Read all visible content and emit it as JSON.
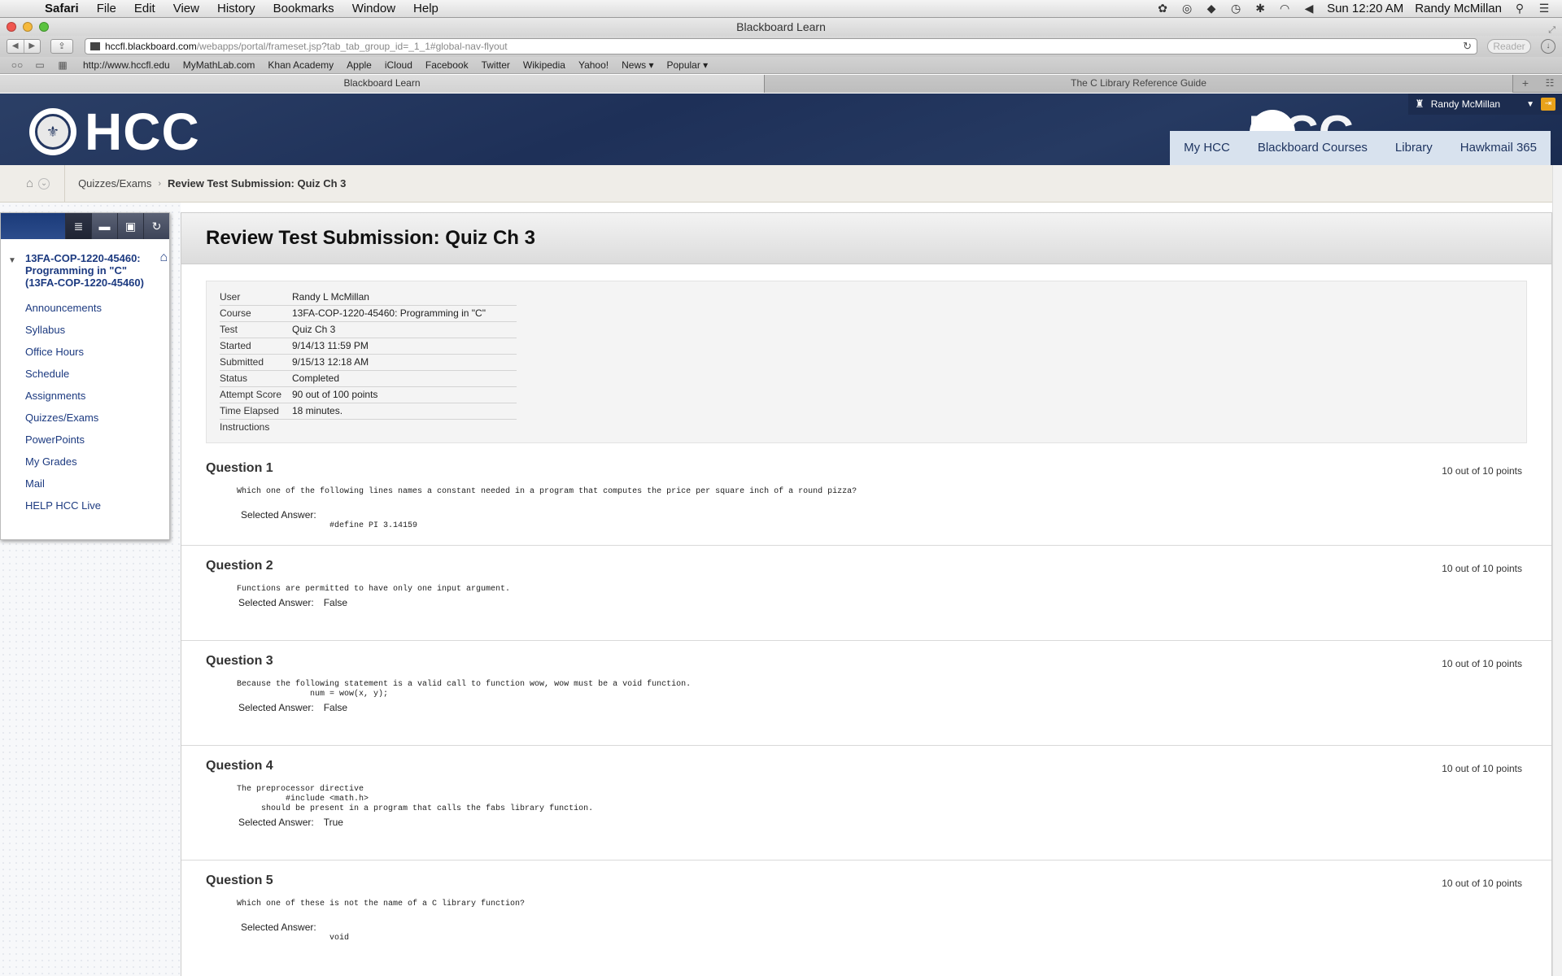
{
  "menubar": {
    "app": "Safari",
    "items": [
      "File",
      "Edit",
      "View",
      "History",
      "Bookmarks",
      "Window",
      "Help"
    ],
    "clock": "Sun 12:20 AM",
    "user": "Randy McMillan"
  },
  "window": {
    "title": "Blackboard Learn"
  },
  "toolbar": {
    "url_host": "hccfl.blackboard.com",
    "url_path": "/webapps/portal/frameset.jsp?tab_tab_group_id=_1_1#global-nav-flyout",
    "reader_label": "Reader"
  },
  "bookmarks": [
    "http://www.hccfl.edu",
    "MyMathLab.com",
    "Khan Academy",
    "Apple",
    "iCloud",
    "Facebook",
    "Twitter",
    "Wikipedia",
    "Yahoo!",
    "News ▾",
    "Popular ▾"
  ],
  "tabs": {
    "active": "Blackboard Learn",
    "inactive": "The C Library Reference Guide"
  },
  "header": {
    "logo": "HCC",
    "user": "Randy McMillan",
    "nav": [
      "My HCC",
      "Blackboard Courses",
      "Library",
      "Hawkmail 365"
    ]
  },
  "breadcrumb": {
    "parent": "Quizzes/Exams",
    "current": "Review Test Submission: Quiz Ch 3"
  },
  "sidebar": {
    "course": "13FA-COP-1220-45460: Programming in \"C\" (13FA-COP-1220-45460)",
    "items": [
      "Announcements",
      "Syllabus",
      "Office Hours",
      "Schedule",
      "Assignments",
      "Quizzes/Exams",
      "PowerPoints",
      "My Grades",
      "Mail",
      "HELP HCC Live"
    ]
  },
  "main": {
    "title": "Review Test Submission: Quiz Ch 3",
    "info": [
      {
        "k": "User",
        "v": "Randy L McMillan"
      },
      {
        "k": "Course",
        "v": "13FA-COP-1220-45460: Programming in \"C\""
      },
      {
        "k": "Test",
        "v": "Quiz Ch 3"
      },
      {
        "k": "Started",
        "v": "9/14/13 11:59 PM"
      },
      {
        "k": "Submitted",
        "v": "9/15/13 12:18 AM"
      },
      {
        "k": "Status",
        "v": "Completed"
      },
      {
        "k": "Attempt Score",
        "v": "90 out of 100 points"
      },
      {
        "k": "Time Elapsed",
        "v": "18 minutes."
      },
      {
        "k": "Instructions",
        "v": ""
      }
    ],
    "selected_label": "Selected Answer:",
    "questions": [
      {
        "title": "Question 1",
        "points": "10 out of 10 points",
        "text": "Which one of the following lines names a constant needed in a program that computes the price per square inch of a round pizza?",
        "answer": "#define PI 3.14159"
      },
      {
        "title": "Question 2",
        "points": "10 out of 10 points",
        "text": "Functions are permitted to have only one input argument.",
        "answer": "False"
      },
      {
        "title": "Question 3",
        "points": "10 out of 10 points",
        "text": "Because the following statement is a valid call to function wow, wow must be a void function.\n               num = wow(x, y);",
        "answer": "False"
      },
      {
        "title": "Question 4",
        "points": "10 out of 10 points",
        "text": "The preprocessor directive\n          #include <math.h>\n     should be present in a program that calls the fabs library function.",
        "answer": "True"
      },
      {
        "title": "Question 5",
        "points": "10 out of 10 points",
        "text": "Which one of these is not the name of a C library function?",
        "answer": "void"
      }
    ]
  }
}
